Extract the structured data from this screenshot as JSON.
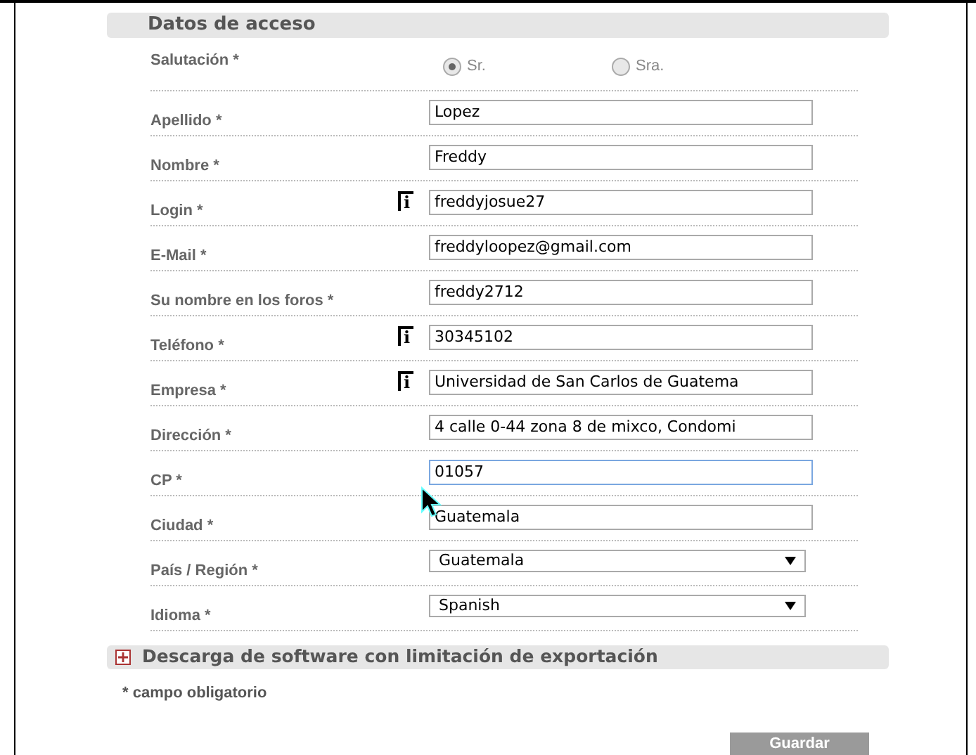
{
  "section": {
    "title": "Datos de acceso"
  },
  "fields": [
    {
      "kind": "radio",
      "label": "Salutación *",
      "options": [
        {
          "label": "Sr.",
          "selected": true
        },
        {
          "label": "Sra.",
          "selected": false
        }
      ]
    },
    {
      "kind": "text",
      "label": "Apellido *",
      "value": "Lopez",
      "info": false,
      "focused": false
    },
    {
      "kind": "text",
      "label": "Nombre *",
      "value": "Freddy",
      "info": false,
      "focused": false
    },
    {
      "kind": "text",
      "label": "Login *",
      "value": "freddyjosue27",
      "info": true,
      "info_label": "i",
      "focused": false
    },
    {
      "kind": "text",
      "label": "E-Mail *",
      "value": "freddyloopez@gmail.com",
      "info": false,
      "focused": false
    },
    {
      "kind": "text",
      "label": "Su nombre en los foros *",
      "value": "freddy2712",
      "info": false,
      "focused": false
    },
    {
      "kind": "text",
      "label": "Teléfono *",
      "value": "30345102",
      "info": true,
      "info_label": "i",
      "focused": false
    },
    {
      "kind": "text",
      "label": "Empresa *",
      "value": "Universidad de San Carlos de Guatema",
      "info": true,
      "info_label": "i",
      "focused": false
    },
    {
      "kind": "text",
      "label": "Dirección *",
      "value": "4 calle 0-44 zona 8 de mixco, Condomi",
      "info": false,
      "focused": false
    },
    {
      "kind": "text",
      "label": "CP *",
      "value": "01057",
      "info": false,
      "focused": true
    },
    {
      "kind": "text",
      "label": "Ciudad *",
      "value": "Guatemala",
      "info": false,
      "focused": false
    },
    {
      "kind": "select",
      "label": "País / Región *",
      "value": "Guatemala"
    },
    {
      "kind": "select",
      "label": "Idioma *",
      "value": "Spanish"
    }
  ],
  "export_section": {
    "title": "Descarga de software con limitación de exportación",
    "expanded": false
  },
  "note": "* campo obligatorio",
  "save_button": "Guardar"
}
